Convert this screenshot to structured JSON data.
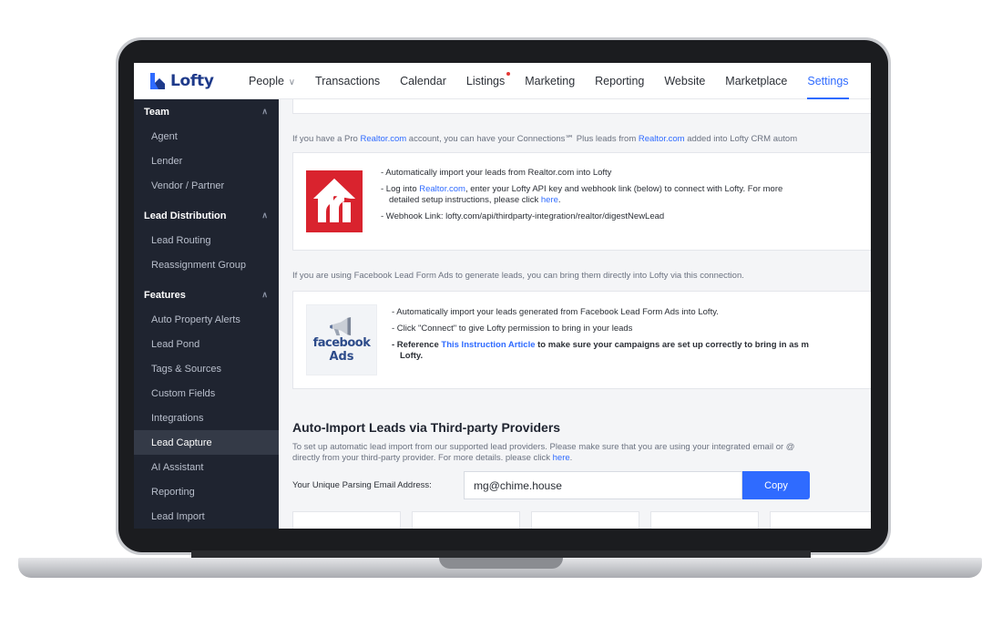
{
  "brand": {
    "name": "Lofty",
    "color": "#1e3a8a",
    "accent": "#2f6bff"
  },
  "topnav": {
    "items": [
      {
        "label": "People",
        "has_dropdown": true
      },
      {
        "label": "Transactions"
      },
      {
        "label": "Calendar"
      },
      {
        "label": "Listings",
        "has_notification_dot": true
      },
      {
        "label": "Marketing"
      },
      {
        "label": "Reporting"
      },
      {
        "label": "Website"
      },
      {
        "label": "Marketplace"
      },
      {
        "label": "Settings",
        "active": true
      }
    ]
  },
  "sidebar": {
    "sections": [
      {
        "title": "Team",
        "items": [
          "Agent",
          "Lender",
          "Vendor / Partner"
        ]
      },
      {
        "title": "Lead Distribution",
        "items": [
          "Lead Routing",
          "Reassignment Group"
        ]
      },
      {
        "title": "Features",
        "items": [
          "Auto Property Alerts",
          "Lead Pond",
          "Tags & Sources",
          "Custom Fields",
          "Integrations",
          "Lead Capture",
          "AI Assistant",
          "Reporting",
          "Lead Import"
        ]
      }
    ],
    "active_item": "Lead Capture"
  },
  "realtor": {
    "intro_before": "If you have a Pro ",
    "intro_link1": "Realtor.com",
    "intro_middle": " account, you can have your Connections℠ Plus leads from ",
    "intro_link2": "Realtor.com",
    "intro_after": " added into Lofty CRM autom",
    "bullet1": "- Automatically import your leads from Realtor.com into Lofty",
    "bullet2_before": "- Log into ",
    "bullet2_link": "Realtor.com",
    "bullet2_after": ", enter your Lofty API key and webhook link (below) to connect with Lofty. For more",
    "bullet2_line2_before": "detailed setup instructions, please click ",
    "bullet2_line2_link": "here",
    "bullet2_line2_after": ".",
    "bullet3": "- Webhook Link: lofty.com/api/thirdparty-integration/realtor/digestNewLead"
  },
  "facebook": {
    "intro": "If you are using Facebook Lead Form Ads to generate leads, you can bring them directly into Lofty via this connection.",
    "logo_line1": "facebook",
    "logo_line2": "Ads",
    "bullet1": "- Automatically import your leads generated from Facebook Lead Form Ads into Lofty.",
    "bullet2": "- Click \"Connect\" to give Lofty permission to bring in your leads",
    "bullet3_before": "- Reference ",
    "bullet3_link": "This Instruction Article",
    "bullet3_after": " to make sure your campaigns are set up correctly to bring in as m",
    "bullet3_line2": "Lofty."
  },
  "auto_import": {
    "title": "Auto-Import Leads via Third-party Providers",
    "desc_line1": "To set up automatic lead import from our supported lead providers. Please make sure that you are using your integrated email or @",
    "desc_line2_before": "directly from your third-party provider. For more details. please click ",
    "desc_line2_link": "here",
    "desc_line2_after": ".",
    "email_label": "Your Unique Parsing Email Address:",
    "email_value": "mg@chime.house",
    "copy_label": "Copy"
  }
}
